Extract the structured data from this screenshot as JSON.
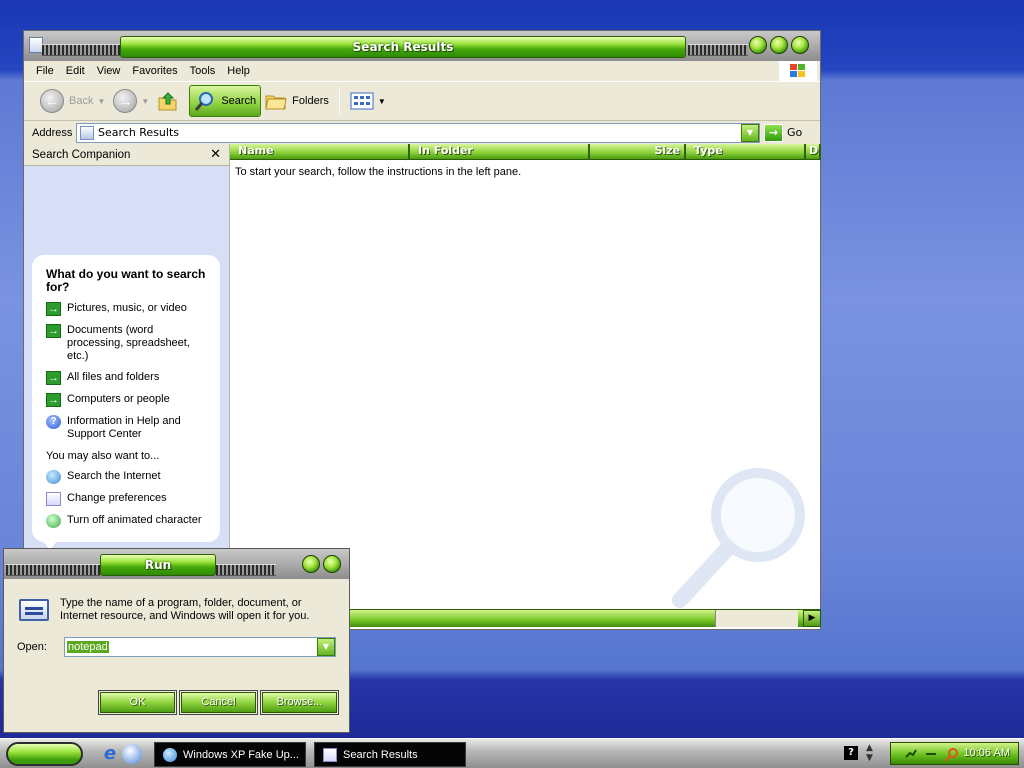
{
  "colors": {
    "accent_green": "#6cc21f",
    "desktop_blue": "#6884d8",
    "pane_blue": "#d6dff5"
  },
  "explorer": {
    "title": "Search Results",
    "menu": [
      "File",
      "Edit",
      "View",
      "Favorites",
      "Tools",
      "Help"
    ],
    "toolbar": {
      "back": "Back",
      "search": "Search",
      "folders": "Folders"
    },
    "address": {
      "label": "Address",
      "value": "Search Results",
      "go": "Go"
    },
    "companion": {
      "header": "Search Companion",
      "question": "What do you want to search for?",
      "options": [
        {
          "icon": "green-arrow-icon",
          "label": "Pictures, music, or video"
        },
        {
          "icon": "green-arrow-icon",
          "label": "Documents (word processing, spreadsheet, etc.)"
        },
        {
          "icon": "green-arrow-icon",
          "label": "All files and folders"
        },
        {
          "icon": "green-arrow-icon",
          "label": "Computers or people"
        },
        {
          "icon": "help-icon",
          "label": "Information in Help and Support Center"
        }
      ],
      "also_label": "You may also want to...",
      "also": [
        {
          "icon": "globe-search-icon",
          "label": "Search the Internet"
        },
        {
          "icon": "preferences-icon",
          "label": "Change preferences"
        },
        {
          "icon": "character-icon",
          "label": "Turn off animated character"
        }
      ]
    },
    "columns": [
      "Name",
      "In Folder",
      "Size",
      "Type",
      "D"
    ],
    "empty_message": "To start your search, follow the instructions in the left pane."
  },
  "run": {
    "title": "Run",
    "description": "Type the name of a program, folder, document, or Internet resource, and Windows will open it for you.",
    "open_label": "Open:",
    "open_value": "notepad",
    "ok": "OK",
    "cancel": "Cancel",
    "browse": "Browse..."
  },
  "taskbar": {
    "tasks": [
      "Windows XP Fake Up...",
      "Search Results"
    ],
    "clock": "10:06 AM"
  }
}
